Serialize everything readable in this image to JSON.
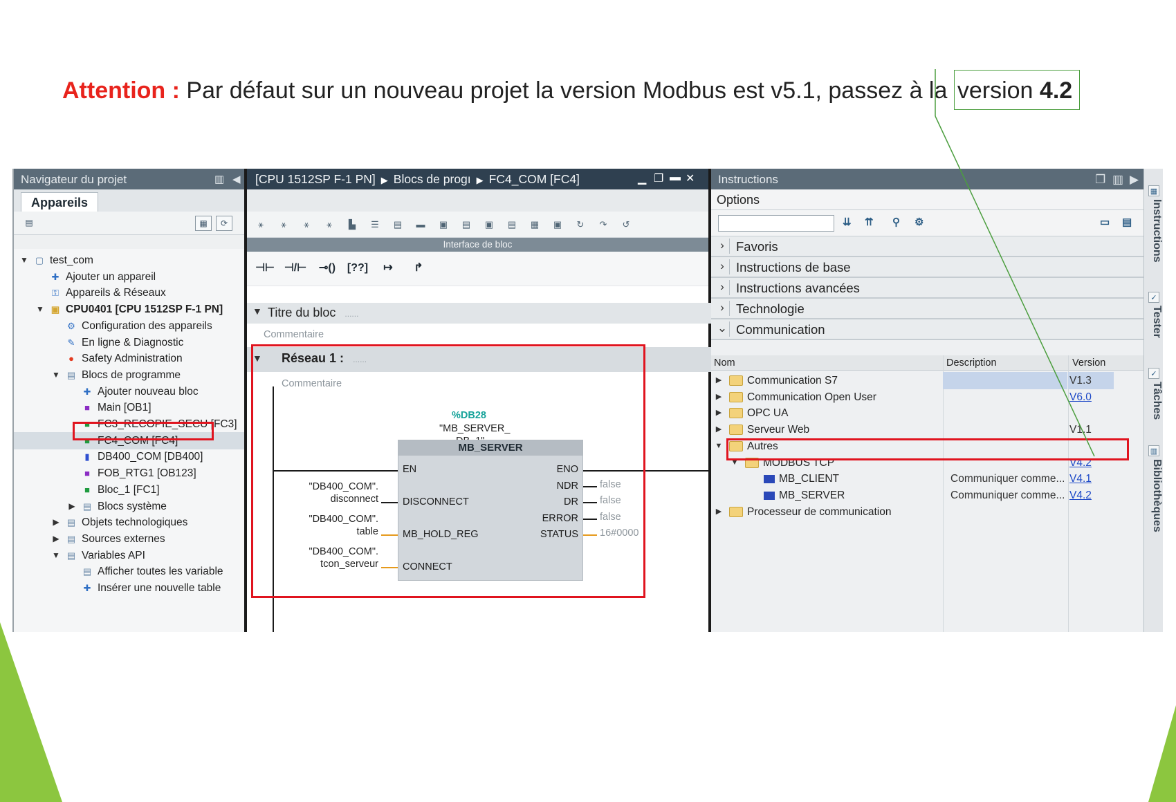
{
  "heading": {
    "attention": "Attention :",
    "text": "Par défaut sur un nouveau projet la version Modbus est v5.1, passez à la",
    "version_word": "version",
    "version_value": "4.2"
  },
  "navigator": {
    "title": "Navigateur du projet",
    "tab": "Appareils",
    "items": [
      {
        "label": "test_com",
        "icon": "project-icon"
      },
      {
        "label": "Ajouter un appareil",
        "icon": "add-device-icon"
      },
      {
        "label": "Appareils & Réseaux",
        "icon": "network-icon"
      },
      {
        "label": "CPU0401 [CPU 1512SP F-1 PN]",
        "icon": "cpu-icon"
      },
      {
        "label": "Configuration des appareils",
        "icon": "device-config-icon"
      },
      {
        "label": "En ligne & Diagnostic",
        "icon": "diagnostic-icon"
      },
      {
        "label": "Safety Administration",
        "icon": "safety-icon"
      },
      {
        "label": "Blocs de programme",
        "icon": "folder-icon"
      },
      {
        "label": "Ajouter nouveau bloc",
        "icon": "add-block-icon"
      },
      {
        "label": "Main [OB1]",
        "icon": "ob-icon"
      },
      {
        "label": "FC3_RECOPIE_SECU [FC3]",
        "icon": "fc-icon"
      },
      {
        "label": "FC4_COM [FC4]",
        "icon": "fc-icon"
      },
      {
        "label": "DB400_COM [DB400]",
        "icon": "db-icon"
      },
      {
        "label": "FOB_RTG1 [OB123]",
        "icon": "ob-icon"
      },
      {
        "label": "Bloc_1 [FC1]",
        "icon": "fc-icon"
      },
      {
        "label": "Blocs système",
        "icon": "folder-icon"
      },
      {
        "label": "Objets technologiques",
        "icon": "folder-icon"
      },
      {
        "label": "Sources externes",
        "icon": "folder-icon"
      },
      {
        "label": "Variables API",
        "icon": "folder-icon"
      },
      {
        "label": "Afficher toutes les variable",
        "icon": "variables-icon"
      },
      {
        "label": "Insérer une nouvelle table",
        "icon": "add-table-icon"
      }
    ]
  },
  "editor": {
    "breadcrumb": [
      "[CPU 1512SP F-1 PN]",
      "Blocs de progı",
      "FC4_COM [FC4]"
    ],
    "interface_bar": "Interface de bloc",
    "block_title": "Titre du bloc",
    "block_title_dots": "......",
    "comment": "Commentaire",
    "network_title": "Réseau 1 :",
    "network_dots": "......",
    "network_comment": "Commentaire",
    "db_address": "%DB28",
    "db_name_1": "\"MB_SERVER_",
    "db_name_2": "DB_1\"",
    "fb_name": "MB_SERVER",
    "pins_in": [
      "EN",
      "DISCONNECT",
      "MB_HOLD_REG",
      "CONNECT"
    ],
    "pins_out": [
      "ENO",
      "NDR",
      "DR",
      "ERROR",
      "STATUS"
    ],
    "inputs": [
      {
        "line1": "\"DB400_COM\".",
        "line2": "disconnect"
      },
      {
        "line1": "\"DB400_COM\".",
        "line2": "table"
      },
      {
        "line1": "\"DB400_COM\".",
        "line2": "tcon_serveur"
      }
    ],
    "outputs": [
      "false",
      "false",
      "false",
      "16#0000"
    ]
  },
  "instructions": {
    "title": "Instructions",
    "options": "Options",
    "search_value": "",
    "categories": [
      "Favoris",
      "Instructions de base",
      "Instructions avancées",
      "Technologie",
      "Communication"
    ],
    "table_headers": {
      "name": "Nom",
      "description": "Description",
      "version": "Version"
    },
    "rows": [
      {
        "name": "Communication S7",
        "description": "",
        "version": "V1.3",
        "link": false
      },
      {
        "name": "Communication Open User",
        "description": "",
        "version": "V6.0",
        "link": true
      },
      {
        "name": "OPC UA",
        "description": "",
        "version": "",
        "link": false
      },
      {
        "name": "Serveur Web",
        "description": "",
        "version": "V1.1",
        "link": false
      },
      {
        "name": "Autres",
        "description": "",
        "version": "",
        "link": false
      },
      {
        "name": "MODBUS TCP",
        "description": "",
        "version": "V4.2",
        "link": true
      },
      {
        "name": "MB_CLIENT",
        "description": "Communiquer comme...",
        "version": "V4.1",
        "link": true
      },
      {
        "name": "MB_SERVER",
        "description": "Communiquer comme...",
        "version": "V4.2",
        "link": true
      },
      {
        "name": "Processeur de communication",
        "description": "",
        "version": "",
        "link": false
      }
    ],
    "side_tabs": [
      "Instructions",
      "Tester",
      "Tâches",
      "Bibliothèques"
    ]
  },
  "colors": {
    "attention": "#e8231c",
    "highlight_box": "#e0141f",
    "callout": "#4c9e3f",
    "link": "#1c48c7"
  }
}
